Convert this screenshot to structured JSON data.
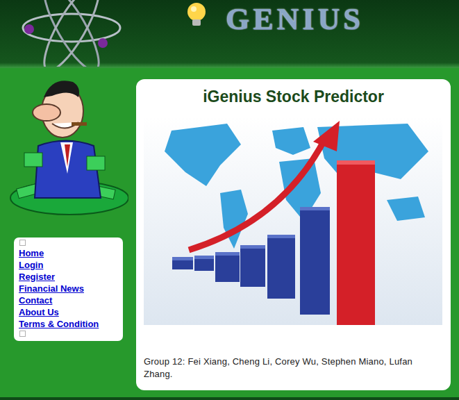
{
  "header": {
    "logo_text": "GENIUS"
  },
  "nav": {
    "items": [
      {
        "label": "Home"
      },
      {
        "label": "Login"
      },
      {
        "label": "Register"
      },
      {
        "label": "Financial News"
      },
      {
        "label": "Contact"
      },
      {
        "label": "About Us"
      },
      {
        "label": "Terms & Condition"
      }
    ]
  },
  "main": {
    "title": "iGenius Stock Predictor",
    "footer": "Group 12: Fei Xiang, Cheng Li, Corey Wu, Stephen Miano, Lufan Zhang."
  }
}
